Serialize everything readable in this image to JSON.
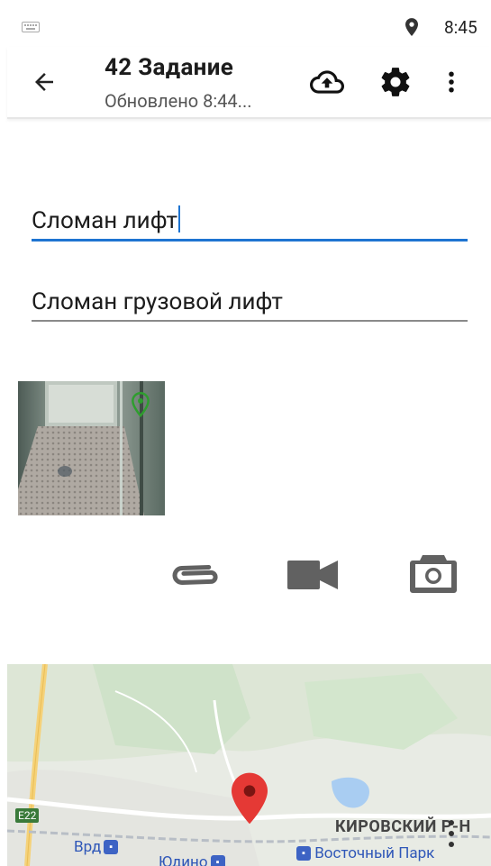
{
  "status_bar": {
    "time": "8:45",
    "keyboard_icon": "keyboard-icon",
    "location_icon": "location-pin-icon"
  },
  "toolbar": {
    "title": "42 Задание",
    "subtitle": "Обновлено 8:44...",
    "back_icon": "arrow-back-icon",
    "upload_icon": "cloud-upload-icon",
    "settings_icon": "gear-icon",
    "menu_icon": "more-vert-icon"
  },
  "form": {
    "title_value": "Сломан лифт",
    "description_value": "Сломан грузовой лифт"
  },
  "attachments": {
    "photo_badge_icon": "location-pin-icon",
    "attach_icon": "paperclip-icon",
    "video_icon": "videocam-icon",
    "camera_icon": "camera-icon"
  },
  "map": {
    "labels": {
      "district": "КИРОВСКИЙ Р-Н",
      "station1": "Врд",
      "station2": "Юдино",
      "station3": "Восточный Парк",
      "road": "E22"
    },
    "marker_color": "#e53935"
  },
  "colors": {
    "accent": "#1e74d1",
    "icon_gray": "#616161",
    "marker": "#e53935"
  }
}
